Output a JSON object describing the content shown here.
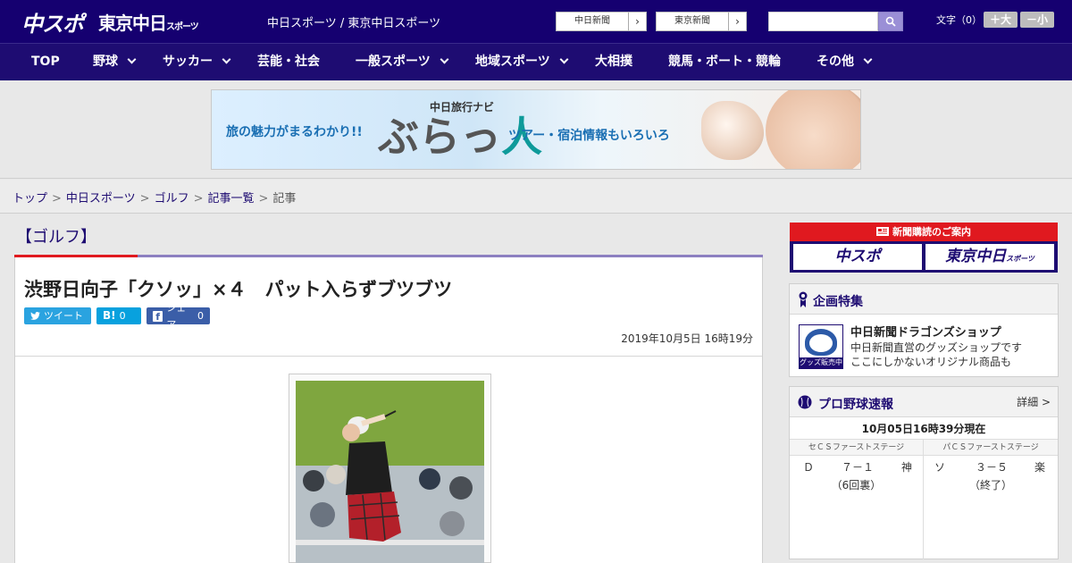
{
  "header": {
    "logo_chuspo": "中スポ",
    "logo_tokyo": "東京中日",
    "logo_tokyo_small": "スポーツ",
    "site_title": "中日スポーツ / 東京中日スポーツ",
    "link_chunichi": "中日新聞",
    "link_tokyo": "東京新聞",
    "arrow_glyph": "›",
    "search_placeholder": "",
    "font_size_label": "文字（0）",
    "font_bigger": "＋大",
    "font_smaller": "－小"
  },
  "nav": {
    "items": [
      {
        "label": "TOP"
      },
      {
        "label": "野球"
      },
      {
        "label": "サッカー"
      },
      {
        "label": "芸能・社会"
      },
      {
        "label": "一般スポーツ"
      },
      {
        "label": "地域スポーツ"
      },
      {
        "label": "大相撲"
      },
      {
        "label": "競馬・ボート・競輪"
      },
      {
        "label": "その他"
      }
    ]
  },
  "banner": {
    "left_text": "旅の魅力がまるわかり!!",
    "small_title": "中日旅行ナビ",
    "big_text_a": "ぶらっ",
    "big_text_b": "人",
    "right_text": "ツアー・宿泊情報もいろいろ"
  },
  "breadcrumb": {
    "items": [
      "トップ",
      "中日スポーツ",
      "ゴルフ",
      "記事一覧"
    ],
    "current": "記事",
    "separator": ">"
  },
  "article": {
    "category": "【ゴルフ】",
    "headline": "渋野日向子「クソッ」×４　パット入らずブツブツ",
    "tweet_label": "ツイート",
    "hatena_logo": "B!",
    "hatena_count": "0",
    "facebook_logo": "f",
    "facebook_label": "シェア",
    "facebook_count": "0",
    "date": "2019年10月5日 16時19分"
  },
  "sidebar": {
    "subscribe_header": "新聞購読のご案内",
    "subscribe_chuspo": "中スポ",
    "subscribe_tokyo": "東京中日",
    "subscribe_tokyo_small": "スポーツ",
    "feature_title": "企画特集",
    "feature_item_title": "中日新聞ドラゴンズショップ",
    "feature_item_desc1": "中日新聞直営のグッズショップです",
    "feature_item_desc2": "ここにしかないオリジナル商品も",
    "feature_logo_label": "グッズ販売中",
    "score_title": "プロ野球速報",
    "score_detail": "詳細 >",
    "score_time": "10月05日16時39分現在",
    "games": [
      {
        "stage": "セＣＳファーストステージ",
        "home": "Ｄ",
        "score": "７－１",
        "away": "神",
        "status": "（6回裏）"
      },
      {
        "stage": "パＣＳファーストステージ",
        "home": "ソ",
        "score": "３－５",
        "away": "楽",
        "status": "（終了）"
      }
    ]
  },
  "colors": {
    "brand_navy": "#150070",
    "nav_navy": "#1e0c72",
    "accent_red": "#e0191f",
    "twitter": "#2aa3e0",
    "hatena": "#08a1de",
    "facebook": "#3b5ea8"
  }
}
